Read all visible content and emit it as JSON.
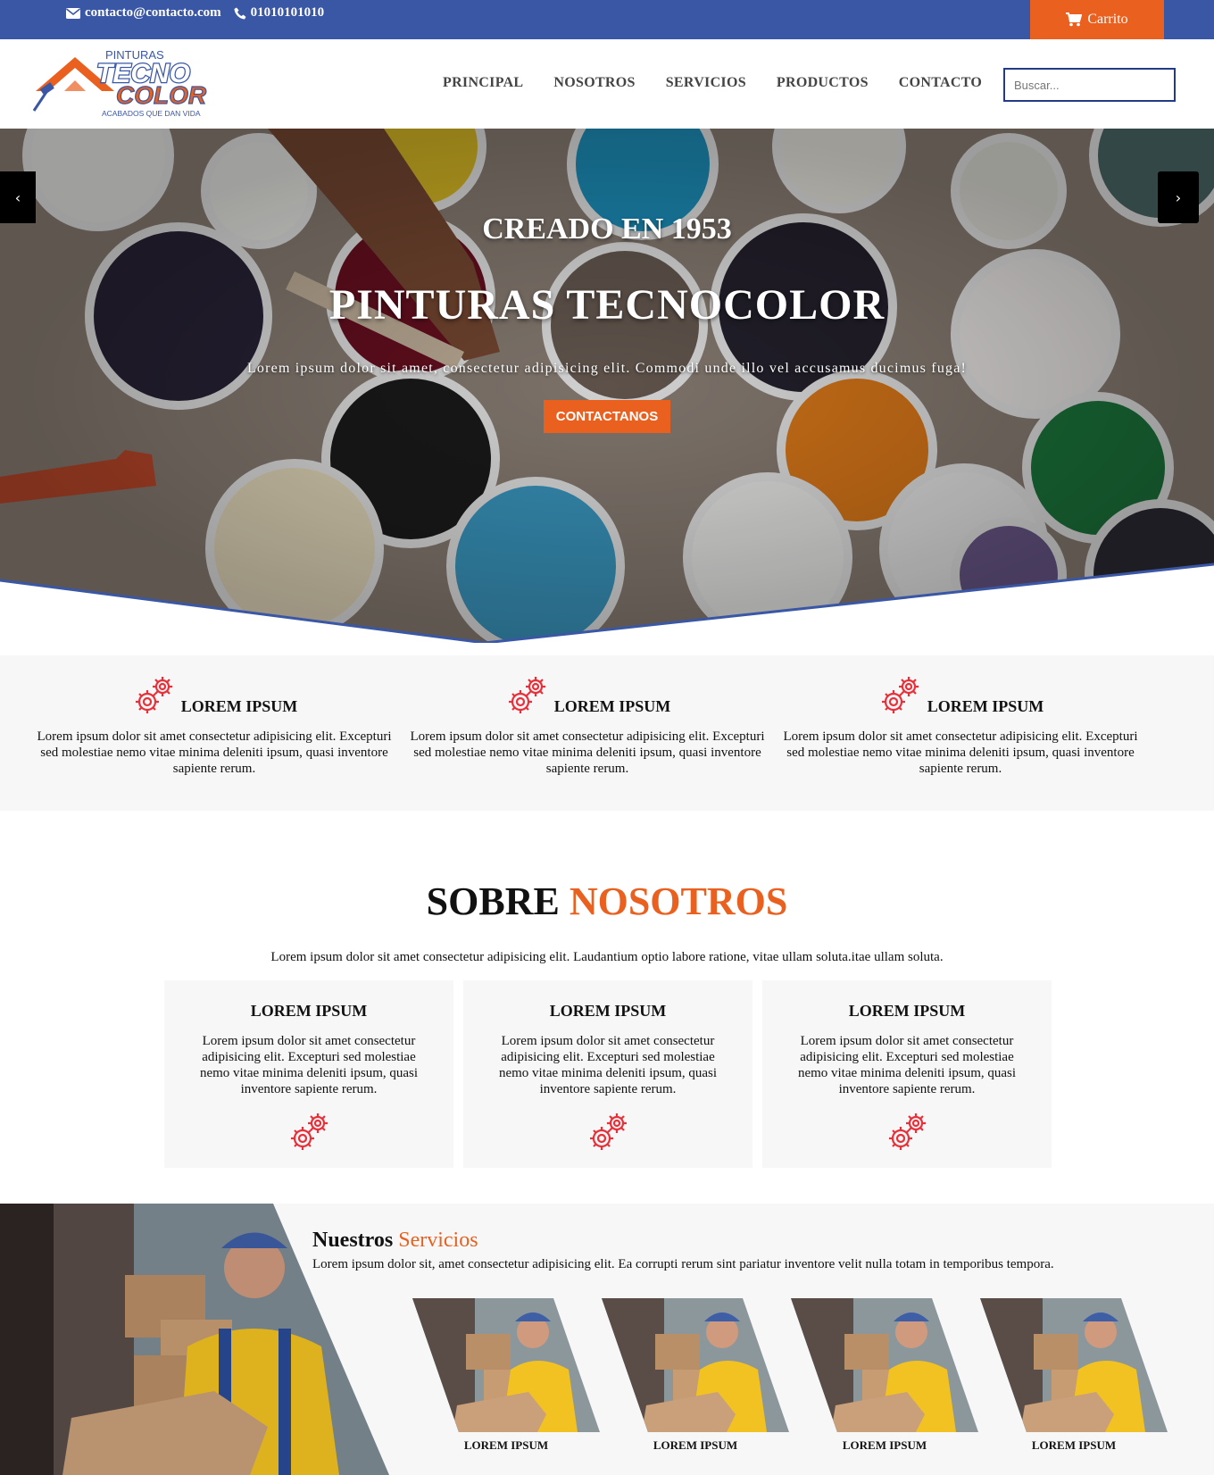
{
  "topbar": {
    "email": "contacto@contacto.com",
    "phone": "01010101010",
    "cart_label": "Carrito"
  },
  "logo": {
    "line1": "PINTURAS",
    "line2": "TECNO",
    "line3": "COLOR",
    "tagline": "ACABADOS QUE DAN VIDA"
  },
  "nav": {
    "items": [
      "PRINCIPAL",
      "NOSOTROS",
      "SERVICIOS",
      "PRODUCTOS",
      "CONTACTO"
    ],
    "search_placeholder": "Buscar..."
  },
  "hero": {
    "prev_label": "‹",
    "next_label": "›",
    "subtitle": "CREADO EN 1953",
    "title": "PINTURAS TECNOCOLOR",
    "text": "Lorem ipsum dolor sit amet, consectetur adipisicing elit. Commodi unde illo vel accusamus ducimus fuga!",
    "button": "CONTACTANOS"
  },
  "features": [
    {
      "icon": "gears-icon",
      "title": "LOREM IPSUM",
      "text": "Lorem ipsum dolor sit amet consectetur adipisicing elit. Excepturi sed molestiae nemo vitae minima deleniti ipsum, quasi inventore sapiente rerum."
    },
    {
      "icon": "gears-icon",
      "title": "LOREM IPSUM",
      "text": "Lorem ipsum dolor sit amet consectetur adipisicing elit. Excepturi sed molestiae nemo vitae minima deleniti ipsum, quasi inventore sapiente rerum."
    },
    {
      "icon": "gears-icon",
      "title": "LOREM IPSUM",
      "text": "Lorem ipsum dolor sit amet consectetur adipisicing elit. Excepturi sed molestiae nemo vitae minima deleniti ipsum, quasi inventore sapiente rerum."
    }
  ],
  "about": {
    "title_part1": "SOBRE",
    "title_part2": "NOSOTROS",
    "text": "Lorem ipsum dolor sit amet consectetur adipisicing elit. Laudantium optio labore ratione, vitae ullam soluta.itae ullam soluta.",
    "cards": [
      {
        "title": "LOREM IPSUM",
        "text": "Lorem ipsum dolor sit amet consectetur adipisicing elit. Excepturi sed molestiae nemo vitae minima deleniti ipsum, quasi inventore sapiente rerum."
      },
      {
        "title": "LOREM IPSUM",
        "text": "Lorem ipsum dolor sit amet consectetur adipisicing elit. Excepturi sed molestiae nemo vitae minima deleniti ipsum, quasi inventore sapiente rerum."
      },
      {
        "title": "LOREM IPSUM",
        "text": "Lorem ipsum dolor sit amet consectetur adipisicing elit. Excepturi sed molestiae nemo vitae minima deleniti ipsum, quasi inventore sapiente rerum."
      }
    ]
  },
  "services": {
    "title_part1": "Nuestros",
    "title_part2": "Servicios",
    "text": "Lorem ipsum dolor sit, amet consectetur adipisicing elit. Ea corrupti rerum sint pariatur inventore velit nulla totam in temporibus tempora.",
    "items": [
      {
        "label": "LOREM IPSUM"
      },
      {
        "label": "LOREM IPSUM"
      },
      {
        "label": "LOREM IPSUM"
      },
      {
        "label": "LOREM IPSUM"
      }
    ]
  },
  "colors": {
    "brand_blue": "#3a57a5",
    "accent_orange": "#e9601f",
    "icon_red": "#e8303a"
  }
}
